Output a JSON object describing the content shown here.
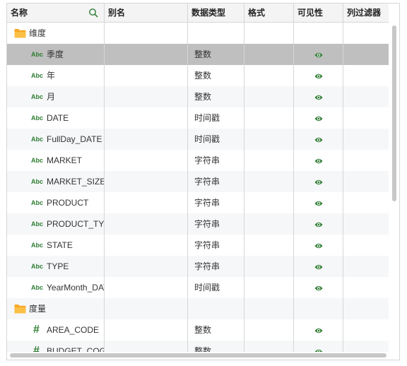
{
  "columns": [
    "名称",
    "别名",
    "数据类型",
    "格式",
    "可见性",
    "列过滤器"
  ],
  "colors": {
    "type_icon": "#2e7d32",
    "eye": "#2e7d32",
    "folder": "#f6a823",
    "selected_row": "#bfbfbf"
  },
  "icons": {
    "search": "search-icon",
    "folder": "folder-icon",
    "string_type": "Abc",
    "number_type": "#",
    "visible": "eye-icon"
  },
  "rows": [
    {
      "kind": "folder",
      "name": "维度",
      "type": "",
      "visible": false
    },
    {
      "kind": "field",
      "icon": "Abc",
      "name": "季度",
      "type": "整数",
      "visible": true,
      "selected": true
    },
    {
      "kind": "field",
      "icon": "Abc",
      "name": "年",
      "type": "整数",
      "visible": true
    },
    {
      "kind": "field",
      "icon": "Abc",
      "name": "月",
      "type": "整数",
      "visible": true
    },
    {
      "kind": "field",
      "icon": "Abc",
      "name": "DATE",
      "type": "时间戳",
      "visible": true
    },
    {
      "kind": "field",
      "icon": "Abc",
      "name": "FullDay_DATE",
      "type": "时间戳",
      "visible": true
    },
    {
      "kind": "field",
      "icon": "Abc",
      "name": "MARKET",
      "type": "字符串",
      "visible": true
    },
    {
      "kind": "field",
      "icon": "Abc",
      "name": "MARKET_SIZE",
      "type": "字符串",
      "visible": true
    },
    {
      "kind": "field",
      "icon": "Abc",
      "name": "PRODUCT",
      "type": "字符串",
      "visible": true
    },
    {
      "kind": "field",
      "icon": "Abc",
      "name": "PRODUCT_TYPE",
      "type": "字符串",
      "visible": true
    },
    {
      "kind": "field",
      "icon": "Abc",
      "name": "STATE",
      "type": "字符串",
      "visible": true
    },
    {
      "kind": "field",
      "icon": "Abc",
      "name": "TYPE",
      "type": "字符串",
      "visible": true
    },
    {
      "kind": "field",
      "icon": "Abc",
      "name": "YearMonth_DATE",
      "type": "时间戳",
      "visible": true
    },
    {
      "kind": "folder",
      "name": "度量",
      "type": "",
      "visible": false
    },
    {
      "kind": "field",
      "icon": "#",
      "name": "AREA_CODE",
      "type": "整数",
      "visible": true
    },
    {
      "kind": "field",
      "icon": "#",
      "name": "BUDGET_COGS",
      "type": "整数",
      "visible": true
    }
  ]
}
